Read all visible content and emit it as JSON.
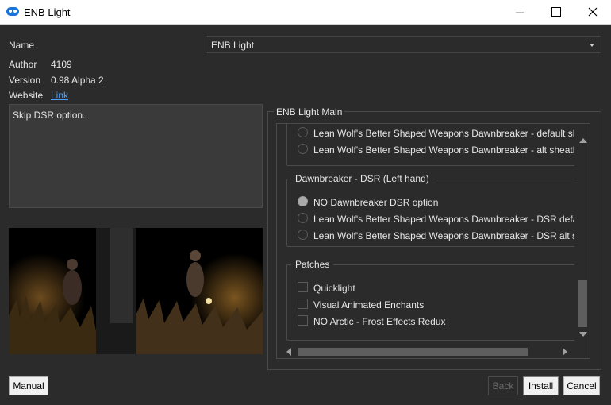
{
  "window": {
    "title": "ENB Light"
  },
  "info": {
    "name_label": "Name",
    "name_value": "ENB Light",
    "author_label": "Author",
    "author_value": "4109",
    "version_label": "Version",
    "version_value": "0.98 Alpha 2",
    "website_label": "Website",
    "website_link": "Link"
  },
  "description": "Skip DSR option.",
  "main": {
    "title": "ENB Light Main",
    "top_options": [
      {
        "label": "Lean Wolf's Better Shaped Weapons Dawnbreaker - default sheath",
        "checked": false
      },
      {
        "label": "Lean Wolf's Better Shaped Weapons Dawnbreaker - alt sheath",
        "checked": false
      }
    ],
    "dsr_group": {
      "title": "Dawnbreaker - DSR (Left hand)",
      "options": [
        {
          "label": "NO Dawnbreaker DSR option",
          "checked": true
        },
        {
          "label": "Lean Wolf's Better Shaped Weapons Dawnbreaker - DSR default sheath",
          "checked": false
        },
        {
          "label": "Lean Wolf's Better Shaped Weapons Dawnbreaker - DSR alt sheath",
          "checked": false
        }
      ]
    },
    "patches_group": {
      "title": "Patches",
      "options": [
        {
          "label": "Quicklight",
          "checked": false
        },
        {
          "label": "Visual Animated Enchants",
          "checked": false
        },
        {
          "label": "NO Arctic - Frost Effects Redux",
          "checked": false
        }
      ]
    }
  },
  "buttons": {
    "manual": "Manual",
    "back": "Back",
    "install": "Install",
    "cancel": "Cancel"
  },
  "colors": {
    "background": "#2b2b2b",
    "link": "#4ea1ff",
    "app_icon": "#1a73d9"
  }
}
